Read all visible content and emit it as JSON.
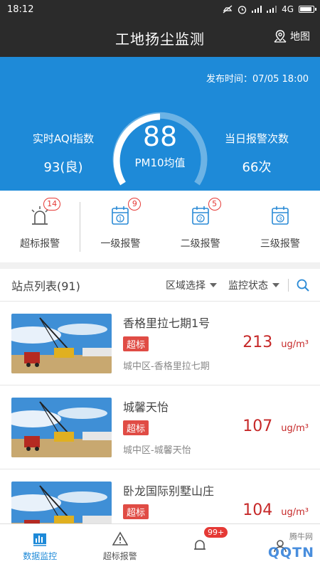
{
  "status": {
    "time": "18:12",
    "network": "4G"
  },
  "header": {
    "title": "工地扬尘监测",
    "map_label": "地图"
  },
  "hero": {
    "publish_time": "发布时间：07/05 18:00",
    "aqi_label": "实时AQI指数",
    "aqi_value": "93(良)",
    "pm10_value": "88",
    "pm10_label": "PM10均值",
    "alarm_label": "当日报警次数",
    "alarm_value": "66次"
  },
  "alarms": [
    {
      "label": "超标报警",
      "count": "14"
    },
    {
      "label": "一级报警",
      "count": "9"
    },
    {
      "label": "二级报警",
      "count": "5"
    },
    {
      "label": "三级报警",
      "count": ""
    }
  ],
  "list": {
    "title": "站点列表(91)",
    "filter_region": "区域选择",
    "filter_status": "监控状态",
    "items": [
      {
        "name": "香格里拉七期1号",
        "tag": "超标",
        "area": "城中区-香格里拉七期",
        "value": "213",
        "unit": "ug/m³"
      },
      {
        "name": "城馨天怡",
        "tag": "超标",
        "area": "城中区-城馨天怡",
        "value": "107",
        "unit": "ug/m³"
      },
      {
        "name": "卧龙国际别墅山庄",
        "tag": "超标",
        "area": "",
        "value": "104",
        "unit": "ug/m³"
      }
    ]
  },
  "tabs": [
    {
      "label": "数据监控"
    },
    {
      "label": "超标报警"
    },
    {
      "label": "",
      "badge": "99+"
    },
    {
      "label": ""
    }
  ],
  "watermark": {
    "small": "腾牛网",
    "big": "QQTN"
  },
  "colors": {
    "accent": "#1e8ad8",
    "alert": "#e53935",
    "dark": "#2b2b2b"
  }
}
